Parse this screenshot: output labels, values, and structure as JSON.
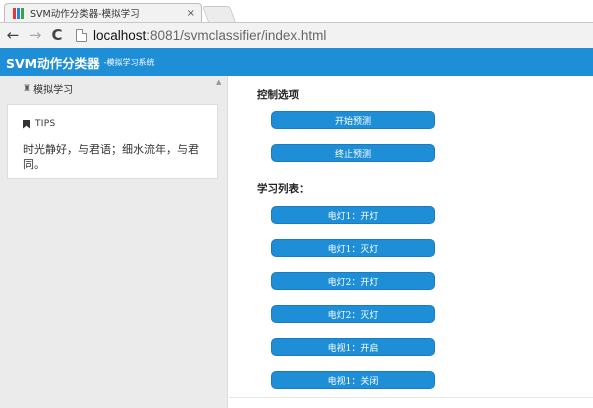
{
  "browser": {
    "tab_title": "SVM动作分类器-模拟学习",
    "tab_close": "×",
    "url_host": "localhost",
    "url_path": ":8081/svmclassifier/index.html",
    "favicon_colors": [
      "#e53935",
      "#1e88e5",
      "#43a047"
    ]
  },
  "header": {
    "brand": "SVM动作分类器",
    "subtitle": "-模拟学习系统",
    "bg_color": "#1e8fd7"
  },
  "sidebar": {
    "menu_icon": "home-icon",
    "menu_label": "模拟学习",
    "tips": {
      "title": "TIPS",
      "text": "时光静好，与君语；细水流年，与君同。"
    }
  },
  "main": {
    "control_title": "控制选项",
    "control_buttons": [
      "开始预测",
      "终止预测"
    ],
    "list_title": "学习列表：",
    "learn_buttons": [
      "电灯1：开灯",
      "电灯1：灭灯",
      "电灯2：开灯",
      "电灯2：灭灯",
      "电视1：开启",
      "电视1：关闭"
    ],
    "button_color": "#1e8fd7"
  }
}
